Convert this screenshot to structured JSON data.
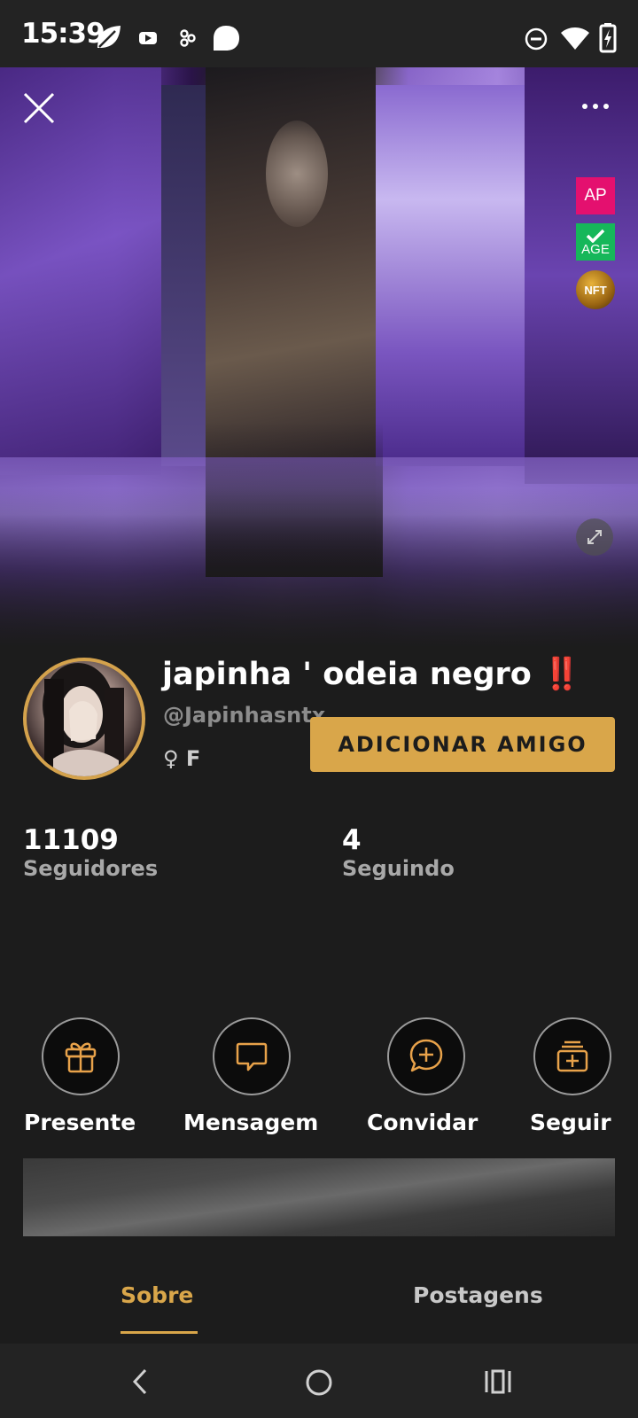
{
  "status_bar": {
    "time": "15:39",
    "left_icons": [
      "leaf-icon",
      "video-icon",
      "connect-icon",
      "chat-bubble-icon"
    ],
    "right_icons": [
      "do-not-disturb-icon",
      "wifi-icon",
      "battery-charging-icon"
    ]
  },
  "cover": {
    "badges": {
      "ap": "AP",
      "age": "AGE",
      "nft": "NFT"
    },
    "badge_colors": {
      "ap": "#e4106f",
      "age": "#16b75a",
      "nft": "#c88a1e"
    }
  },
  "profile": {
    "display_name": "japinha ' odeia negro ‼️",
    "username": "@Japinhasntx",
    "gender": "♀ F",
    "add_friend_label": "ADICIONAR AMIGO"
  },
  "stats": {
    "followers_count": "11109",
    "followers_label": "Seguidores",
    "following_count": "4",
    "following_label": "Seguindo"
  },
  "actions": [
    {
      "label": "Presente",
      "icon": "gift-icon"
    },
    {
      "label": "Mensagem",
      "icon": "message-icon"
    },
    {
      "label": "Convidar",
      "icon": "invite-chat-plus-icon"
    },
    {
      "label": "Seguir",
      "icon": "follow-folder-plus-icon"
    }
  ],
  "tabs": [
    {
      "label": "Sobre",
      "active": true
    },
    {
      "label": "Postagens",
      "active": false
    }
  ],
  "colors": {
    "accent": "#d9a64a",
    "background": "#1c1c1c",
    "bars": "#232323"
  },
  "nav_bar": {
    "icons": [
      "back-icon",
      "home-icon",
      "recents-icon"
    ]
  }
}
